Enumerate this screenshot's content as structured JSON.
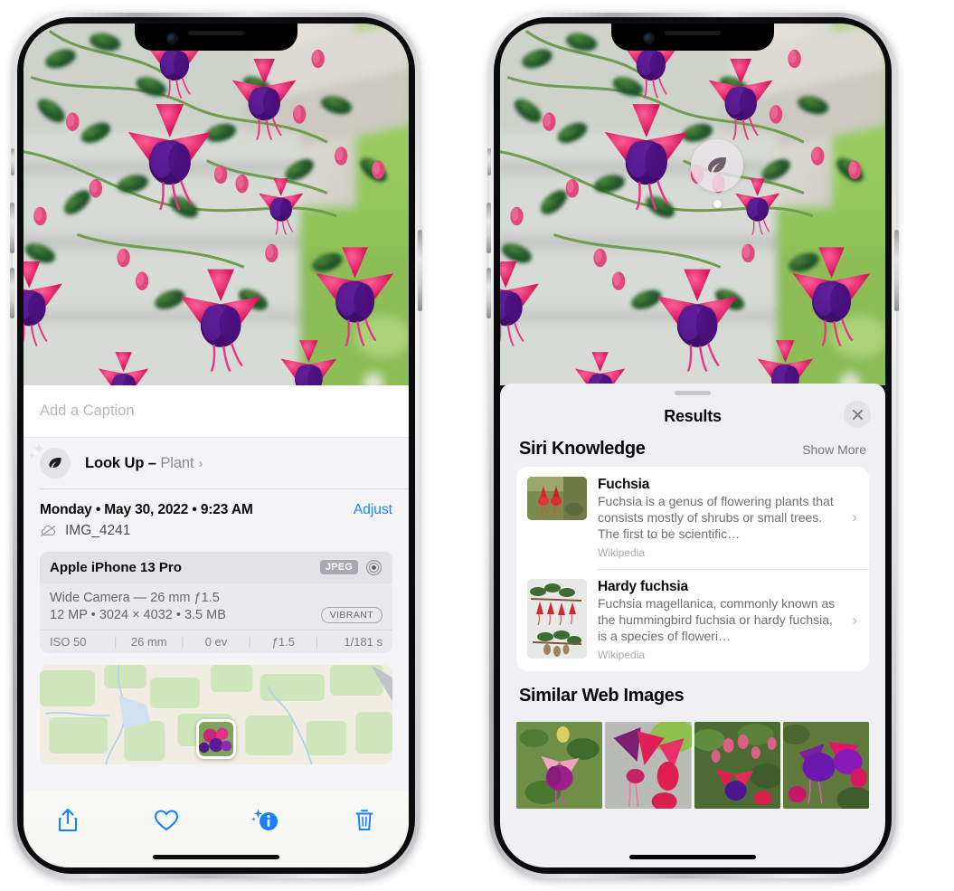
{
  "left_phone": {
    "caption_field": {
      "placeholder": "Add a Caption",
      "value": ""
    },
    "lookup_row": {
      "label": "Look Up – ",
      "subject": "Plant",
      "icon": "leaf-icon",
      "chevron": "›"
    },
    "date_row": {
      "datetime": "Monday • May 30, 2022 • 9:23 AM",
      "adjust_label": "Adjust"
    },
    "filename_row": {
      "icon": "cloud-slash-icon",
      "filename": "IMG_4241"
    },
    "metadata_card": {
      "device": "Apple iPhone 13 Pro",
      "format_badge": "JPEG",
      "aperture_icon": "aperture-icon",
      "lens_line": "Wide Camera — 26 mm ƒ1.5",
      "size_line": "12 MP • 3024 × 4032 • 3.5 MB",
      "style_pill": "VIBRANT",
      "exif": [
        {
          "label": "ISO 50"
        },
        {
          "label": "26 mm"
        },
        {
          "label": "0 ev"
        },
        {
          "label": "ƒ1.5"
        },
        {
          "label": "1/181 s"
        }
      ],
      "separator": "|"
    },
    "toolbar": [
      {
        "name": "share-icon",
        "label": "Share"
      },
      {
        "name": "heart-icon",
        "label": "Favorite"
      },
      {
        "name": "info-sparkle-icon",
        "label": "Info"
      },
      {
        "name": "trash-icon",
        "label": "Delete"
      }
    ]
  },
  "right_phone": {
    "lookup_badge": {
      "icon": "leaf-icon"
    },
    "sheet": {
      "title": "Results",
      "close_icon": "close-icon"
    },
    "siri_knowledge": {
      "heading": "Siri Knowledge",
      "show_more": "Show More",
      "entries": [
        {
          "title": "Fuchsia",
          "description": "Fuchsia is a genus of flowering plants that consists mostly of shrubs or small trees. The first to be scientific…",
          "source": "Wikipedia",
          "chevron": "›"
        },
        {
          "title": "Hardy fuchsia",
          "description": "Fuchsia magellanica, commonly known as the hummingbird fuchsia or hardy fuchsia, is a species of floweri…",
          "source": "Wikipedia",
          "chevron": "›"
        }
      ]
    },
    "similar_web_images": {
      "heading": "Similar Web Images",
      "count": 4
    }
  },
  "colors": {
    "accent_blue": "#1a80ff",
    "sheet_bg": "#f0f0f4",
    "card_bg": "#ffffff",
    "muted_text": "#6e6e75"
  }
}
